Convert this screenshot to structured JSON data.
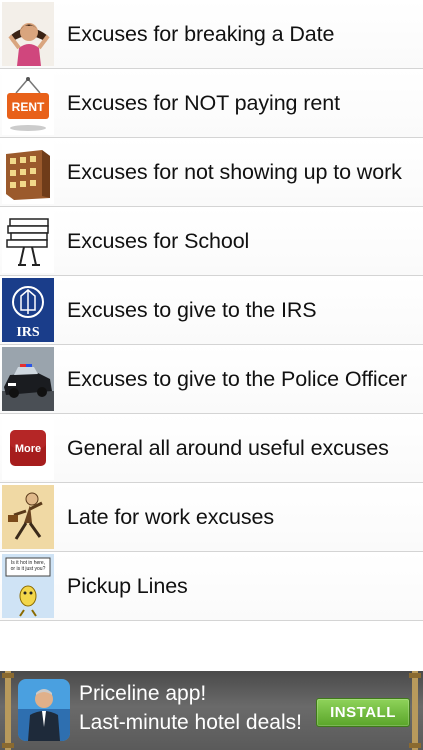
{
  "items": [
    {
      "label": "Excuses for breaking a Date",
      "icon": "girl-upset-icon"
    },
    {
      "label": "Excuses for NOT paying rent",
      "icon": "rent-sign-icon",
      "icon_text": "RENT"
    },
    {
      "label": "Excuses for not showing up to work",
      "icon": "office-building-icon"
    },
    {
      "label": "Excuses for School",
      "icon": "student-books-icon"
    },
    {
      "label": "Excuses to give to the IRS",
      "icon": "irs-logo-icon",
      "icon_text": "IRS"
    },
    {
      "label": "Excuses to give to the Police Officer",
      "icon": "police-car-icon"
    },
    {
      "label": "General all around useful excuses",
      "icon": "more-icon",
      "icon_text": "More"
    },
    {
      "label": "Late for work excuses",
      "icon": "running-man-icon"
    },
    {
      "label": "Pickup Lines",
      "icon": "cartoon-speech-icon",
      "icon_text": "Is it hot in here, or is it just you?"
    }
  ],
  "ad": {
    "line1": "Priceline app!",
    "line2": "Last-minute hotel deals!",
    "install_label": "INSTALL",
    "colors": {
      "button": "#6bbd3a",
      "background": "#5a5a5a"
    }
  }
}
